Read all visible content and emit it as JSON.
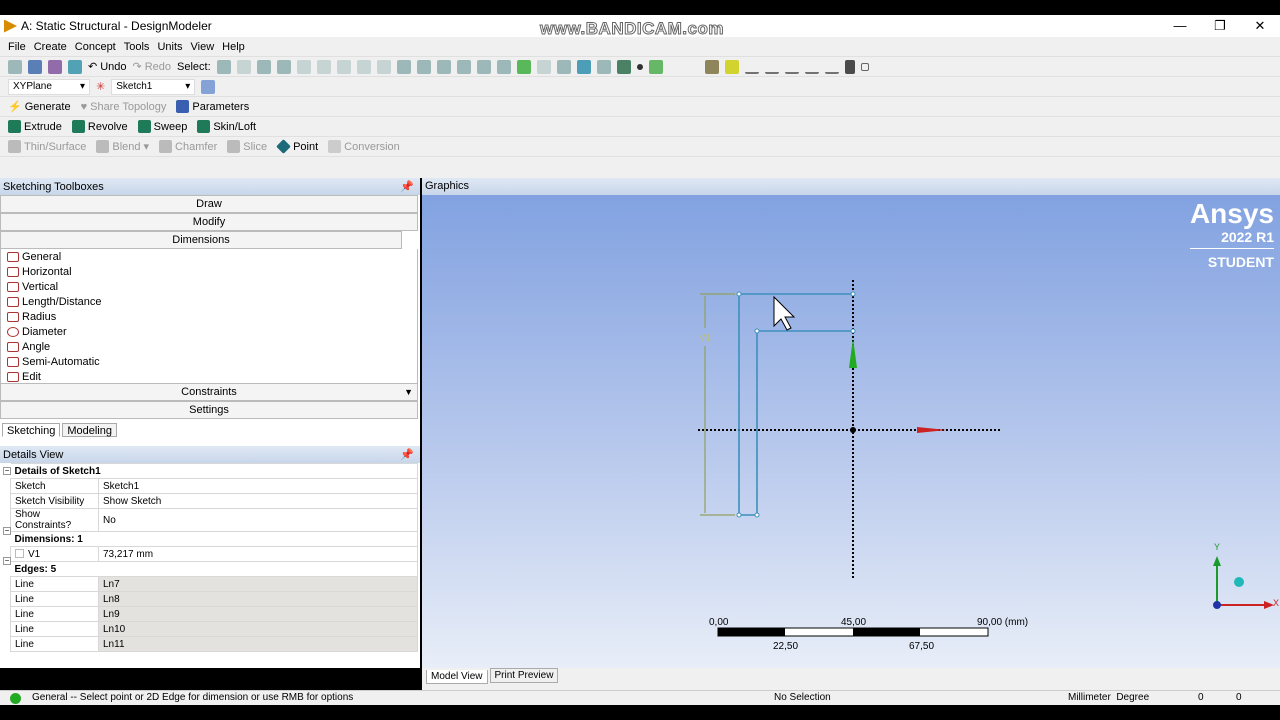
{
  "window": {
    "title": "A: Static Structural - DesignModeler",
    "watermark": "www.BANDICAM.com",
    "min": "—",
    "max": "❐",
    "close": "✕"
  },
  "menu": [
    "File",
    "Create",
    "Concept",
    "Tools",
    "Units",
    "View",
    "Help"
  ],
  "toolbar": {
    "undo": "Undo",
    "redo": "Redo",
    "select": "Select:"
  },
  "plane": {
    "plane": "XYPlane",
    "sketch": "Sketch1"
  },
  "toolbar2": {
    "generate": "Generate",
    "share_topology": "Share Topology",
    "parameters": "Parameters"
  },
  "toolbar3": {
    "extrude": "Extrude",
    "revolve": "Revolve",
    "sweep": "Sweep",
    "skin_loft": "Skin/Loft"
  },
  "toolbar4": {
    "thin_surface": "Thin/Surface",
    "blend": "Blend",
    "chamfer": "Chamfer",
    "slice": "Slice",
    "point": "Point",
    "conversion": "Conversion"
  },
  "toolboxes": {
    "title": "Sketching Toolboxes",
    "draw": "Draw",
    "modify": "Modify",
    "dimensions": "Dimensions",
    "constraints": "Constraints",
    "settings": "Settings",
    "items": [
      "General",
      "Horizontal",
      "Vertical",
      "Length/Distance",
      "Radius",
      "Diameter",
      "Angle",
      "Semi-Automatic",
      "Edit"
    ]
  },
  "tabs": {
    "sketching": "Sketching",
    "modeling": "Modeling"
  },
  "details": {
    "title": "Details View",
    "group1": "Details of Sketch1",
    "rows1": [
      {
        "k": "Sketch",
        "v": "Sketch1"
      },
      {
        "k": "Sketch Visibility",
        "v": "Show Sketch"
      },
      {
        "k": "Show Constraints?",
        "v": "No"
      }
    ],
    "group2": "Dimensions: 1",
    "dim": {
      "k": "V1",
      "v": "73,217 mm"
    },
    "group3": "Edges: 5",
    "edges": [
      {
        "k": "Line",
        "v": "Ln7"
      },
      {
        "k": "Line",
        "v": "Ln8"
      },
      {
        "k": "Line",
        "v": "Ln9"
      },
      {
        "k": "Line",
        "v": "Ln10"
      },
      {
        "k": "Line",
        "v": "Ln11"
      }
    ]
  },
  "graphics": {
    "title": "Graphics",
    "brand": "Ansys",
    "version": "2022 R1",
    "edition": "STUDENT",
    "dim_label": "V1",
    "axis_y": "Y",
    "axis_x": "X",
    "scale": {
      "t0": "0,00",
      "t1": "45,00",
      "t2": "90,00 (mm)",
      "b1": "22,50",
      "b2": "67,50"
    }
  },
  "bottom_tabs": {
    "model_view": "Model View",
    "print_preview": "Print Preview"
  },
  "status": {
    "message": "General -- Select point or 2D Edge for dimension or use RMB for options",
    "selection": "No Selection",
    "units": "Millimeter  Degree",
    "v1": "0",
    "v2": "0"
  }
}
